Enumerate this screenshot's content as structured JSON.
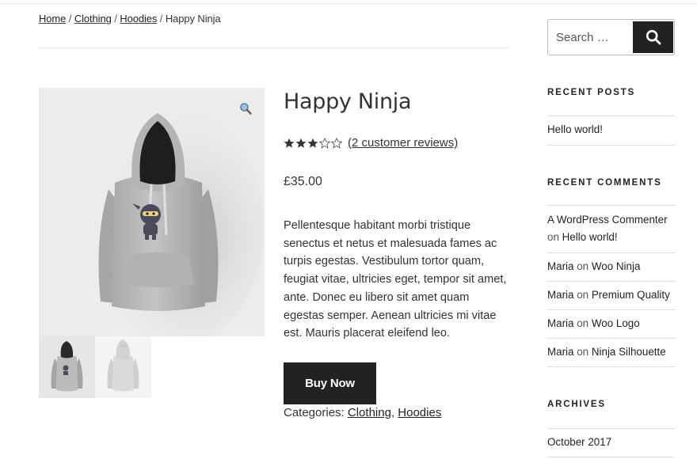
{
  "breadcrumb": {
    "items": [
      "Home",
      "Clothing",
      "Hoodies"
    ],
    "current": "Happy Ninja",
    "separator": "/"
  },
  "product": {
    "title": "Happy Ninja",
    "rating": 3,
    "rating_max": 5,
    "reviews_link": "(2 customer reviews)",
    "price": "£35.00",
    "description": "Pellentesque habitant morbi tristique senectus et netus et malesuada fames ac turpis egestas. Vestibulum tortor quam, feugiat vitae, ultricies eget, tempor sit amet, ante. Donec eu libero sit amet quam egestas semper. Aenean ultricies mi vitae est. Mauris placerat eleifend leo.",
    "buy_label": "Buy Now",
    "categories_label": "Categories:",
    "categories": [
      "Clothing",
      "Hoodies"
    ],
    "categories_sep": ","
  },
  "sidebar": {
    "search_placeholder": "Search …",
    "recent_posts_title": "RECENT POSTS",
    "recent_posts": [
      "Hello world!"
    ],
    "recent_comments_title": "RECENT COMMENTS",
    "recent_comments": [
      {
        "author": "A WordPress Commenter",
        "on": "on",
        "post": "Hello world!"
      },
      {
        "author": "Maria",
        "on": "on",
        "post": "Woo Ninja"
      },
      {
        "author": "Maria",
        "on": "on",
        "post": "Premium Quality"
      },
      {
        "author": "Maria",
        "on": "on",
        "post": "Woo Logo"
      },
      {
        "author": "Maria",
        "on": "on",
        "post": "Ninja Silhouette"
      }
    ],
    "archives_title": "ARCHIVES",
    "archives": [
      "October 2017"
    ]
  },
  "colors": {
    "text": "#333333",
    "button_bg": "#222222",
    "button_text": "#ffffff",
    "gallery_bg": "#ececec",
    "hoodie": "#bdbdbd"
  },
  "icons": [
    "magnifier-zoom-icon",
    "search-icon",
    "star-icon"
  ]
}
